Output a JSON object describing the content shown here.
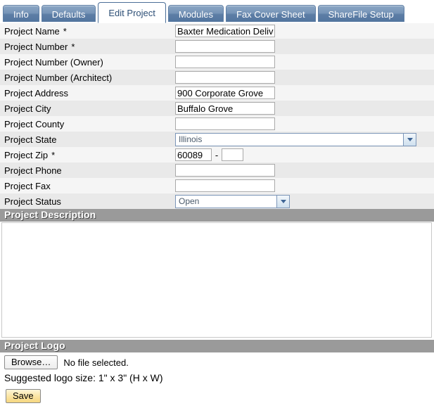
{
  "tabs": [
    {
      "label": "Info",
      "active": false
    },
    {
      "label": "Defaults",
      "active": false
    },
    {
      "label": "Edit Project",
      "active": true
    },
    {
      "label": "Modules",
      "active": false
    },
    {
      "label": "Fax Cover Sheet",
      "active": false
    },
    {
      "label": "ShareFile Setup",
      "active": false
    }
  ],
  "form": {
    "required_marker": "*",
    "rows": [
      {
        "label": "Project Name",
        "required": true,
        "type": "text",
        "value": "Baxter Medication Delivery"
      },
      {
        "label": "Project Number",
        "required": true,
        "type": "text",
        "value": ""
      },
      {
        "label": "Project Number (Owner)",
        "required": false,
        "type": "text",
        "value": ""
      },
      {
        "label": "Project Number (Architect)",
        "required": false,
        "type": "text",
        "value": ""
      },
      {
        "label": "Project Address",
        "required": false,
        "type": "text",
        "value": "900 Corporate Grove"
      },
      {
        "label": "Project City",
        "required": false,
        "type": "text",
        "value": "Buffalo Grove"
      },
      {
        "label": "Project County",
        "required": false,
        "type": "text",
        "value": ""
      },
      {
        "label": "Project State",
        "required": false,
        "type": "select",
        "value": "Illinois"
      },
      {
        "label": "Project Zip",
        "required": true,
        "type": "zip",
        "value": "60089",
        "value2": "",
        "separator": "-"
      },
      {
        "label": "Project Phone",
        "required": false,
        "type": "text",
        "value": ""
      },
      {
        "label": "Project Fax",
        "required": false,
        "type": "text",
        "value": ""
      },
      {
        "label": "Project Status",
        "required": false,
        "type": "select",
        "value": "Open"
      }
    ]
  },
  "description": {
    "header": "Project Description",
    "value": ""
  },
  "logo": {
    "header": "Project Logo",
    "browse_label": "Browse…",
    "no_file_text": "No file selected.",
    "hint": "Suggested logo size: 1\" x 3\" (H x W)"
  },
  "actions": {
    "save_label": "Save"
  },
  "colors": {
    "tab_active_text": "#2d4f76",
    "tab_inactive_bg": "#7795b8",
    "section_header_bg": "#9a9a9a",
    "row_odd": "#f5f5f5",
    "row_even": "#e9e9e9",
    "save_button": "#fae3a0"
  }
}
